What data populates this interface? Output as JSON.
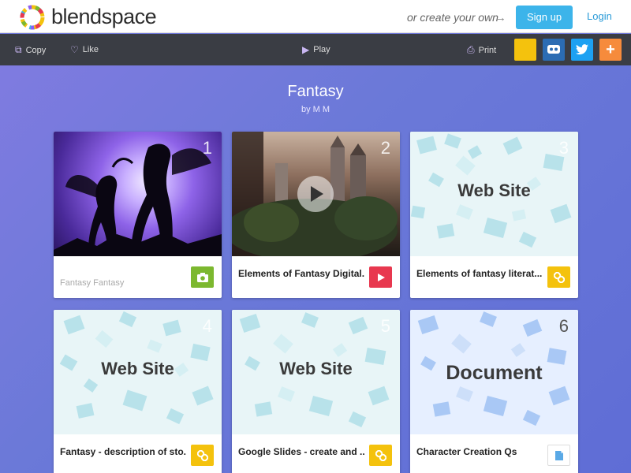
{
  "brand": {
    "logo_text": "blendspace"
  },
  "header": {
    "create_own": "or create your own",
    "signup_label": "Sign up",
    "login_label": "Login"
  },
  "toolbar": {
    "copy_label": "Copy",
    "like_label": "Like",
    "play_label": "Play",
    "print_label": "Print"
  },
  "lesson": {
    "title": "Fantasy",
    "byline": "by M M"
  },
  "cards": [
    {
      "num": "1",
      "label": "Fantasy Fantasy",
      "type": "camera-icon"
    },
    {
      "num": "2",
      "label": "Elements of Fantasy Digital...",
      "type": "play-icon"
    },
    {
      "num": "3",
      "label": "Elements of fantasy literat...",
      "thumb_text": "Web Site",
      "type": "link-icon"
    },
    {
      "num": "4",
      "label": "Fantasy - description of sto...",
      "thumb_text": "Web Site",
      "type": "link-icon"
    },
    {
      "num": "5",
      "label": "Google Slides - create and ...",
      "thumb_text": "Web Site",
      "type": "link-icon"
    },
    {
      "num": "6",
      "label": "Character Creation Qs",
      "thumb_text": "Document",
      "type": "document-icon"
    }
  ],
  "colors": {
    "signup": "#3cb4ea",
    "toolbar": "#3a3d44",
    "camera_btn": "#7cb82f",
    "play_btn": "#e8384f",
    "link_btn": "#f4c20d",
    "twitter": "#1da1f2",
    "add": "#f68b3c"
  }
}
